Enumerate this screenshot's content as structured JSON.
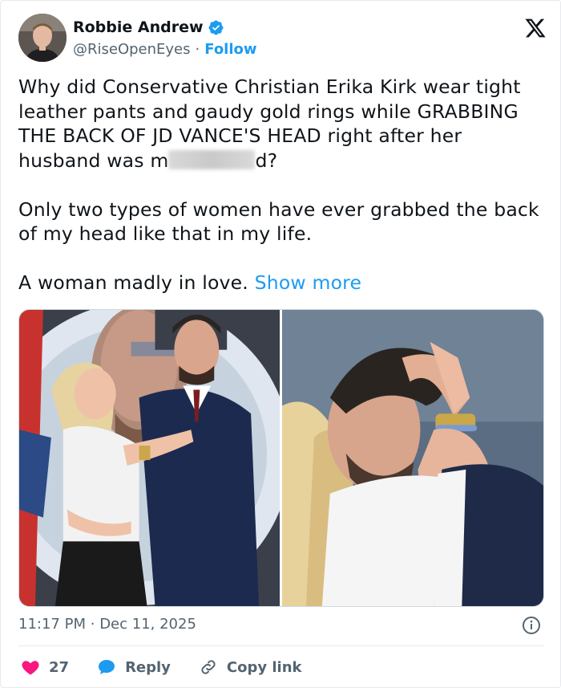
{
  "author": {
    "display_name": "Robbie Andrew",
    "handle": "@RiseOpenEyes",
    "separator": "·",
    "follow_label": "Follow",
    "verified": true
  },
  "brand": {
    "logo": "x-logo-icon"
  },
  "tweet": {
    "line1": "Why did Conservative Christian Erika Kirk wear tight leather pants and gaudy gold rings while GRABBING THE BACK OF JD VANCE'S HEAD right after her husband was m",
    "line1_end": "d?",
    "paragraph2": "Only two types of women have ever grabbed the back of my head like that in my life.",
    "paragraph3": "A woman madly in love.",
    "show_more": "Show more"
  },
  "media": {
    "photo_count": 2
  },
  "meta": {
    "time": "11:17 PM",
    "separator": "·",
    "date": "Dec 11, 2025"
  },
  "actions": {
    "like_count": "27",
    "reply_label": "Reply",
    "copy_link_label": "Copy link"
  },
  "colors": {
    "accent": "#1d9bf0",
    "like": "#f91880",
    "text": "#0f1419",
    "muted": "#536471"
  }
}
